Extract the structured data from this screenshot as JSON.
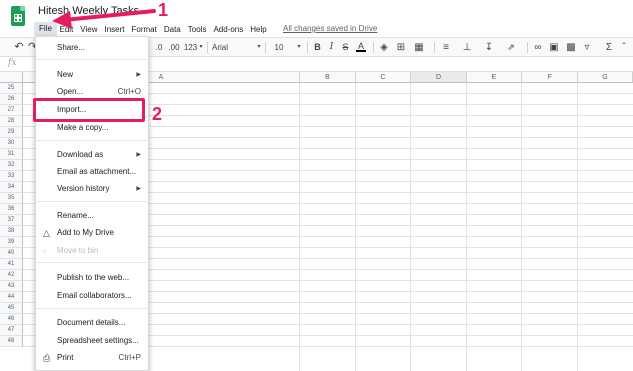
{
  "doc": {
    "title": "Hitesh Weekly Tasks"
  },
  "menubar": [
    "File",
    "Edit",
    "View",
    "Insert",
    "Format",
    "Data",
    "Tools",
    "Add-ons",
    "Help"
  ],
  "saved_status": "All changes saved in Drive",
  "toolbar": {
    "undo_icon": "undo-icon",
    "redo_icon": "redo-icon",
    "decimal_dec": ".0",
    "decimal_inc": ".00",
    "more_formats": "123",
    "font": "Arial",
    "font_size": "10",
    "bold": "B",
    "italic": "I",
    "strike": "S",
    "text_color": "A"
  },
  "formula_bar": {
    "fx": "fx"
  },
  "columns": [
    "A",
    "B",
    "C",
    "D",
    "E",
    "F",
    "G"
  ],
  "rows": [
    "25",
    "26",
    "27",
    "28",
    "29",
    "30",
    "31",
    "32",
    "33",
    "34",
    "35",
    "36",
    "37",
    "38",
    "39",
    "40",
    "41",
    "42",
    "43",
    "44",
    "45",
    "46",
    "47",
    "48"
  ],
  "file_menu": {
    "share": "Share...",
    "new": "New",
    "open": "Open...",
    "open_shortcut": "Ctrl+O",
    "import": "Import...",
    "make_copy": "Make a copy...",
    "download_as": "Download as",
    "email_attachment": "Email as attachment...",
    "version_history": "Version history",
    "rename": "Rename...",
    "add_to_drive": "Add to My Drive",
    "move_to_bin": "Move to bin",
    "publish": "Publish to the web...",
    "email_collaborators": "Email collaborators...",
    "document_details": "Document details...",
    "spreadsheet_settings": "Spreadsheet settings...",
    "print": "Print",
    "print_shortcut": "Ctrl+P"
  },
  "annotations": {
    "step1": "1",
    "step2": "2"
  },
  "colors": {
    "accent": "#e41e5e",
    "sheets_green": "#1e9e55"
  }
}
